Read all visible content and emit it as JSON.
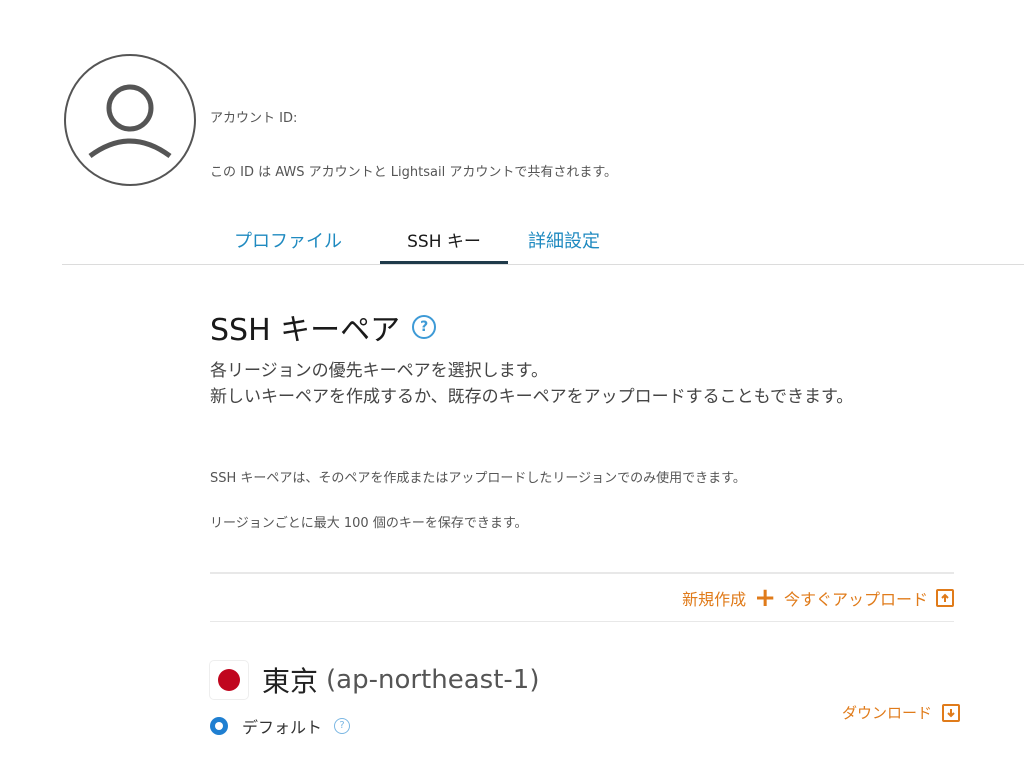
{
  "account": {
    "label": "アカウント ID:",
    "note": "この ID は AWS アカウントと Lightsail アカウントで共有されます。"
  },
  "tabs": [
    {
      "label": "プロファイル",
      "active": false
    },
    {
      "label": "SSH キー",
      "active": true
    },
    {
      "label": "詳細設定",
      "active": false
    }
  ],
  "section": {
    "title": "SSH キーペア",
    "help": "?",
    "description": "各リージョンの優先キーペアを選択します。\n新しいキーペアを作成するか、既存のキーペアをアップロードすることもできます。",
    "note1": "SSH キーペアは、そのペアを作成またはアップロードしたリージョンでのみ使用できます。",
    "note2": "リージョンごとに最大 100 個のキーを保存できます。"
  },
  "actions": {
    "create_label": "新規作成",
    "upload_label": "今すぐアップロード"
  },
  "region": {
    "name": "東京",
    "code": "(ap-northeast-1)",
    "default_label": "デフォルト",
    "help": "?",
    "download_label": "ダウンロード"
  },
  "colors": {
    "link_blue": "#1f8ac0",
    "action_orange": "#e07b1a",
    "radio_blue": "#1f7fd1",
    "flag_red": "#c0061e"
  },
  "icons": {
    "avatar": "user-avatar-icon",
    "help": "question-circle-icon",
    "create": "plus-icon",
    "upload": "upload-icon",
    "download": "download-icon",
    "flag": "japan-flag-icon"
  }
}
